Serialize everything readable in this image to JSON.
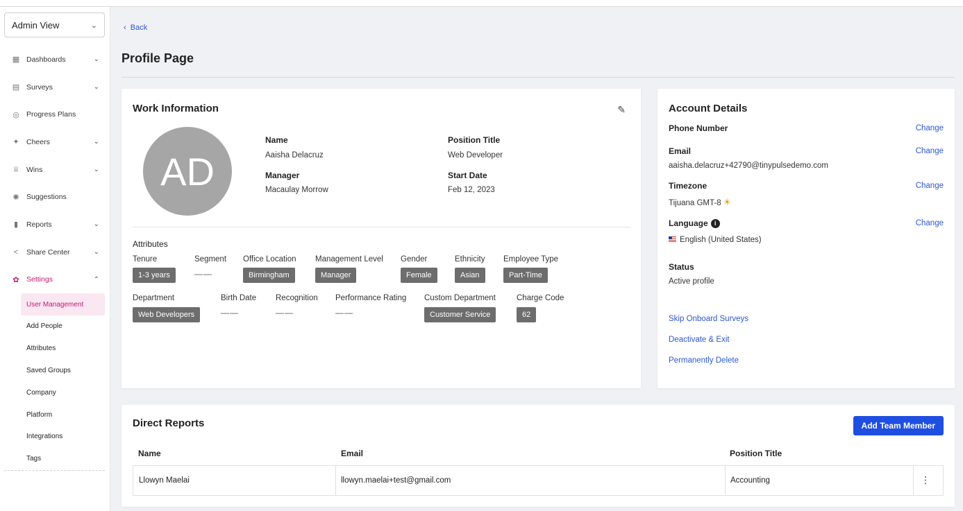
{
  "sidebar": {
    "view_select": "Admin View",
    "items": [
      {
        "label": "Dashboards"
      },
      {
        "label": "Surveys"
      },
      {
        "label": "Progress Plans"
      },
      {
        "label": "Cheers"
      },
      {
        "label": "Wins"
      },
      {
        "label": "Suggestions"
      },
      {
        "label": "Reports"
      },
      {
        "label": "Share Center"
      },
      {
        "label": "Settings"
      }
    ],
    "sub_items": [
      {
        "label": "User Management"
      },
      {
        "label": "Add People"
      },
      {
        "label": "Attributes"
      },
      {
        "label": "Saved Groups"
      },
      {
        "label": "Company"
      },
      {
        "label": "Platform"
      },
      {
        "label": "Integrations"
      },
      {
        "label": "Tags"
      }
    ]
  },
  "header": {
    "back_label": "Back",
    "page_title": "Profile Page"
  },
  "work": {
    "title": "Work Information",
    "avatar_initials": "AD",
    "name_label": "Name",
    "name_value": "Aaisha Delacruz",
    "position_label": "Position Title",
    "position_value": "Web Developer",
    "manager_label": "Manager",
    "manager_value": "Macaulay Morrow",
    "start_label": "Start Date",
    "start_value": "Feb 12, 2023",
    "attributes_title": "Attributes",
    "attrs": {
      "tenure_label": "Tenure",
      "tenure_value": "1-3 years",
      "segment_label": "Segment",
      "segment_value": "——",
      "office_label": "Office Location",
      "office_value": "Birmingham",
      "mgmt_label": "Management Level",
      "mgmt_value": "Manager",
      "gender_label": "Gender",
      "gender_value": "Female",
      "ethnicity_label": "Ethnicity",
      "ethnicity_value": "Asian",
      "emptype_label": "Employee Type",
      "emptype_value": "Part-Time",
      "dept_label": "Department",
      "dept_value": "Web Developers",
      "birth_label": "Birth Date",
      "birth_value": "——",
      "recog_label": "Recognition",
      "recog_value": "——",
      "perf_label": "Performance Rating",
      "perf_value": "——",
      "custdept_label": "Custom Department",
      "custdept_value": "Customer Service",
      "charge_label": "Charge Code",
      "charge_value": "62"
    }
  },
  "account": {
    "title": "Account Details",
    "change_label": "Change",
    "phone_label": "Phone Number",
    "email_label": "Email",
    "email_value": "aaisha.delacruz+42790@tinypulsedemo.com",
    "timezone_label": "Timezone",
    "timezone_value": "Tijuana GMT-8",
    "language_label": "Language",
    "language_value": "English (United States)",
    "status_label": "Status",
    "status_value": "Active profile",
    "skip_link": "Skip Onboard Surveys",
    "deactivate_link": "Deactivate & Exit",
    "delete_link": "Permanently Delete"
  },
  "reports": {
    "title": "Direct Reports",
    "add_button": "Add Team Member",
    "columns": [
      "Name",
      "Email",
      "Position Title"
    ],
    "rows": [
      {
        "name": "Llowyn Maelai",
        "email": "llowyn.maelai+test@gmail.com",
        "position": "Accounting"
      }
    ]
  },
  "colors": {
    "accent": "#c0197a",
    "link": "#2b57d6",
    "primary_button": "#1f4fe0",
    "chip": "#6d6d6d"
  }
}
